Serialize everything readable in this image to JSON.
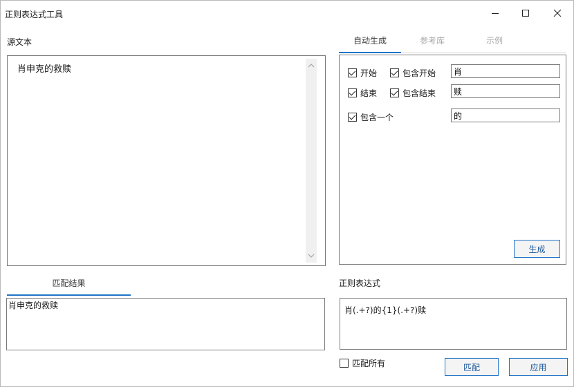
{
  "window": {
    "title": "正则表达式工具"
  },
  "source": {
    "label": "源文本",
    "text": "肖申克的救赎"
  },
  "tabs": [
    {
      "label": "自动生成",
      "active": true
    },
    {
      "label": "参考库",
      "active": false
    },
    {
      "label": "示例",
      "active": false
    }
  ],
  "auto_gen": {
    "start": {
      "label": "开始",
      "checked": true
    },
    "include_start": {
      "label": "包含开始",
      "checked": true
    },
    "start_value": "肖",
    "end": {
      "label": "结束",
      "checked": true
    },
    "include_end": {
      "label": "包含结束",
      "checked": true
    },
    "end_value": "赎",
    "include_one": {
      "label": "包含一个",
      "checked": true
    },
    "include_one_value": "的",
    "generate_label": "生成"
  },
  "match_result": {
    "tab_label": "匹配结果",
    "text": "肖申克的救赎"
  },
  "regex": {
    "label": "正则表达式",
    "value": "肖(.+?)的{1}(.+?)赎"
  },
  "footer": {
    "match_all": {
      "label": "匹配所有",
      "checked": false
    },
    "match_label": "匹配",
    "apply_label": "应用"
  },
  "colors": {
    "accent": "#1e73c8",
    "border": "#7a7a7a"
  }
}
